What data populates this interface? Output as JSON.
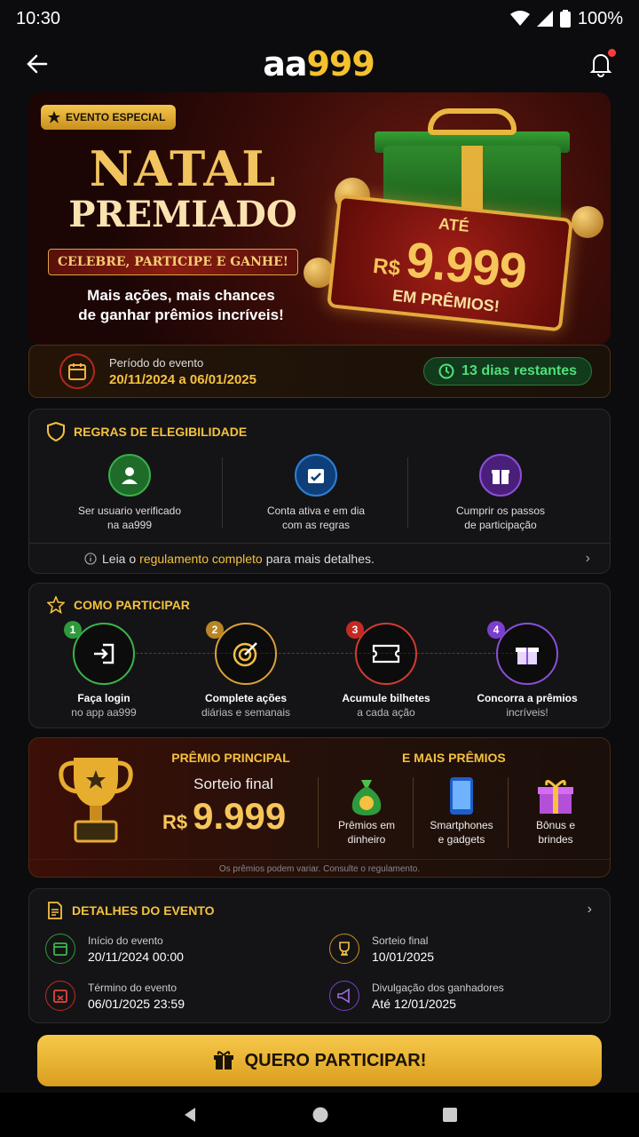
{
  "status": {
    "time": "10:30",
    "battery": "100%"
  },
  "header": {
    "logo_white": "aa",
    "logo_gold": "999"
  },
  "hero": {
    "badge": "EVENTO ESPECIAL",
    "title1": "NATAL",
    "title2": "PREMIADO",
    "ribbon": "CELEBRE, PARTICIPE E GANHE!",
    "subtitle_line1": "Mais ações, mais chances",
    "subtitle_line2": "de ganhar prêmios incríveis!",
    "ticket_top": "ATÉ",
    "ticket_currency": "R$",
    "ticket_value": "9.999",
    "ticket_bottom": "EM PRÊMIOS!"
  },
  "period": {
    "label": "Período do evento",
    "dates": "20/11/2024 a 06/01/2025",
    "remaining": "13 dias restantes"
  },
  "rules": {
    "title": "REGRAS DE ELEGIBILIDADE",
    "items": [
      {
        "line1": "Ser usuario verificado",
        "line2": "na aa999"
      },
      {
        "line1": "Conta ativa e em dia",
        "line2": "com as regras"
      },
      {
        "line1": "Cumprir os passos",
        "line2": "de participação"
      }
    ],
    "footer_pre": "Leia o",
    "footer_link": "regulamento completo",
    "footer_post": "para mais detalhes."
  },
  "steps": {
    "title": "COMO PARTICIPAR",
    "items": [
      {
        "num": "1",
        "a": "Faça login",
        "b": "no app aa999"
      },
      {
        "num": "2",
        "a": "Complete ações",
        "b": "diárias e semanais"
      },
      {
        "num": "3",
        "a": "Acumule bilhetes",
        "b": "a cada ação"
      },
      {
        "num": "4",
        "a": "Concorra a prêmios",
        "b": "incríveis!"
      }
    ]
  },
  "prize": {
    "title": "PRÊMIO PRINCIPAL",
    "sub": "Sorteio final",
    "currency": "R$",
    "value": "9.999",
    "more_title": "E MAIS PRÊMIOS",
    "more": [
      {
        "line1": "Prêmios em",
        "line2": "dinheiro"
      },
      {
        "line1": "Smartphones",
        "line2": "e gadgets"
      },
      {
        "line1": "Bônus e",
        "line2": "brindes"
      }
    ],
    "note": "Os prêmios podem variar. Consulte o regulamento."
  },
  "details": {
    "title": "DETALHES DO EVENTO",
    "items": [
      {
        "label": "Início do evento",
        "value": "20/11/2024 00:00"
      },
      {
        "label": "Sorteio final",
        "value": "10/01/2025"
      },
      {
        "label": "Término do evento",
        "value": "06/01/2025 23:59"
      },
      {
        "label": "Divulgação dos ganhadores",
        "value": "Até 12/01/2025"
      }
    ]
  },
  "cta": {
    "label": "QUERO PARTICIPAR!"
  },
  "colors": {
    "gold": "#f5c13e",
    "green": "#4fe07a",
    "bg": "#0c0c0e"
  }
}
